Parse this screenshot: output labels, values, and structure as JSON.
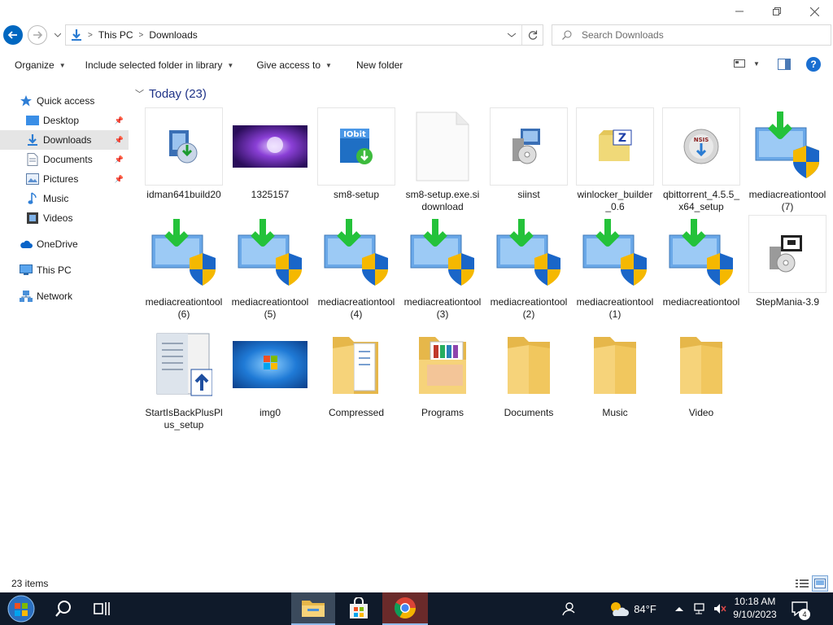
{
  "window": {
    "address": {
      "segments": [
        "This PC",
        "Downloads"
      ]
    },
    "search": {
      "placeholder": "Search Downloads"
    }
  },
  "toolbar": {
    "organize": "Organize",
    "include_library": "Include selected folder in library",
    "give_access": "Give access to",
    "new_folder": "New folder"
  },
  "nav": {
    "quick_access": "Quick access",
    "desktop": "Desktop",
    "downloads": "Downloads",
    "documents": "Documents",
    "pictures": "Pictures",
    "music": "Music",
    "videos": "Videos",
    "onedrive": "OneDrive",
    "this_pc": "This PC",
    "network": "Network"
  },
  "group": {
    "header": "Today (23)"
  },
  "files": [
    {
      "label": "idman641build20",
      "icon": "installer-icon"
    },
    {
      "label": "1325157",
      "icon": "image-thumbnail"
    },
    {
      "label": "sm8-setup",
      "icon": "iobit-installer-icon"
    },
    {
      "label": "sm8-setup.exe.sidownload",
      "icon": "blank-file-icon"
    },
    {
      "label": "siinst",
      "icon": "setup-disc-icon"
    },
    {
      "label": "winlocker_builder_0.6",
      "icon": "archive-icon"
    },
    {
      "label": "qbittorrent_4.5.5_x64_setup",
      "icon": "nsis-installer-icon"
    },
    {
      "label": "mediacreationtool (7)",
      "icon": "media-creation-tool-icon"
    },
    {
      "label": "mediacreationtool (6)",
      "icon": "media-creation-tool-icon"
    },
    {
      "label": "mediacreationtool (5)",
      "icon": "media-creation-tool-icon"
    },
    {
      "label": "mediacreationtool (4)",
      "icon": "media-creation-tool-icon"
    },
    {
      "label": "mediacreationtool (3)",
      "icon": "media-creation-tool-icon"
    },
    {
      "label": "mediacreationtool (2)",
      "icon": "media-creation-tool-icon"
    },
    {
      "label": "mediacreationtool (1)",
      "icon": "media-creation-tool-icon"
    },
    {
      "label": "mediacreationtool",
      "icon": "media-creation-tool-icon"
    },
    {
      "label": "StepMania-3.9",
      "icon": "setup-disc-icon"
    },
    {
      "label": "StartIsBackPlusPlus_setup",
      "icon": "startisback-installer-icon"
    },
    {
      "label": "img0",
      "icon": "windows7-wallpaper-thumbnail"
    },
    {
      "label": "Compressed",
      "icon": "folder-icon"
    },
    {
      "label": "Programs",
      "icon": "folder-icon"
    },
    {
      "label": "Documents",
      "icon": "folder-icon"
    },
    {
      "label": "Music",
      "icon": "folder-icon"
    },
    {
      "label": "Video",
      "icon": "folder-icon"
    }
  ],
  "status": {
    "items": "23 items"
  },
  "taskbar": {
    "weather": "84°F",
    "time": "10:18 AM",
    "date": "9/10/2023",
    "notifications": "4"
  },
  "colors": {
    "accent": "#0067c0",
    "group_header": "#1e3287",
    "taskbar": "#0f1a2a",
    "selection": "#e5e5e5"
  }
}
